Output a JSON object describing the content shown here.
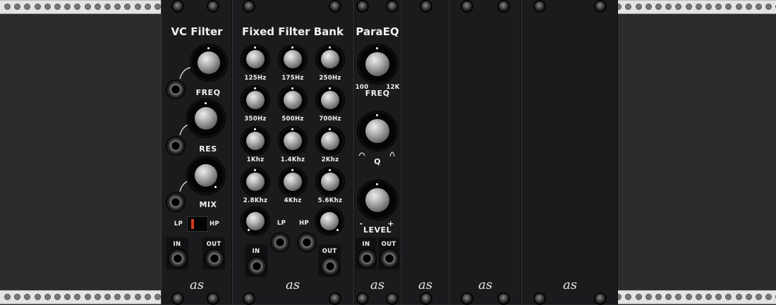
{
  "modules": {
    "vcfilter": {
      "title": "VC Filter",
      "freq": "FREQ",
      "res": "RES",
      "mix": "MIX",
      "lp": "LP",
      "hp": "HP",
      "in": "IN",
      "out": "OUT",
      "logo": "as"
    },
    "filterbank": {
      "title": "Fixed Filter Bank",
      "bands": [
        "125Hz",
        "175Hz",
        "250Hz",
        "350Hz",
        "500Hz",
        "700Hz",
        "1Khz",
        "1.4Khz",
        "2Khz",
        "2.8Khz",
        "4Khz",
        "5.6Khz"
      ],
      "lp": "LP",
      "hp": "HP",
      "in": "IN",
      "out": "OUT",
      "logo": "as"
    },
    "paraeq": {
      "title": "ParaEQ",
      "freq": "FREQ",
      "freq_min": "100",
      "freq_max": "12K",
      "q": "Q",
      "level": "LEVEL",
      "level_minus": "-",
      "level_plus": "+",
      "in": "IN",
      "out": "OUT",
      "logo": "as"
    },
    "blank1": {
      "logo": "as"
    },
    "blank2": {
      "logo": "as"
    },
    "blank3": {
      "logo": "as"
    }
  },
  "switch": {
    "position": "LP"
  },
  "colors": {
    "panel": "#1b1b1e",
    "rail": "#e4e4e4",
    "text": "#f1f1ec",
    "switch_lever": "#d23a1e"
  }
}
